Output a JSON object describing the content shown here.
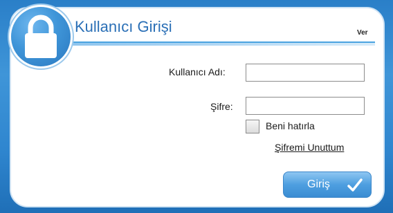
{
  "header": {
    "title": "Kullanıcı Girişi",
    "version": "Ver"
  },
  "form": {
    "username_label": "Kullanıcı Adı:",
    "username_value": "",
    "password_label": "Şifre:",
    "password_value": "",
    "remember_label": "Beni hatırla",
    "remember_checked": false,
    "forgot_link": "Şifremi Unuttum",
    "submit_label": "Giriş"
  },
  "icons": {
    "badge": "lock-icon",
    "submit": "checkmark-icon"
  },
  "colors": {
    "background": "#3f95d8",
    "panel": "#ffffff",
    "title": "#2a6fb6",
    "button": "#4e9fe0"
  }
}
